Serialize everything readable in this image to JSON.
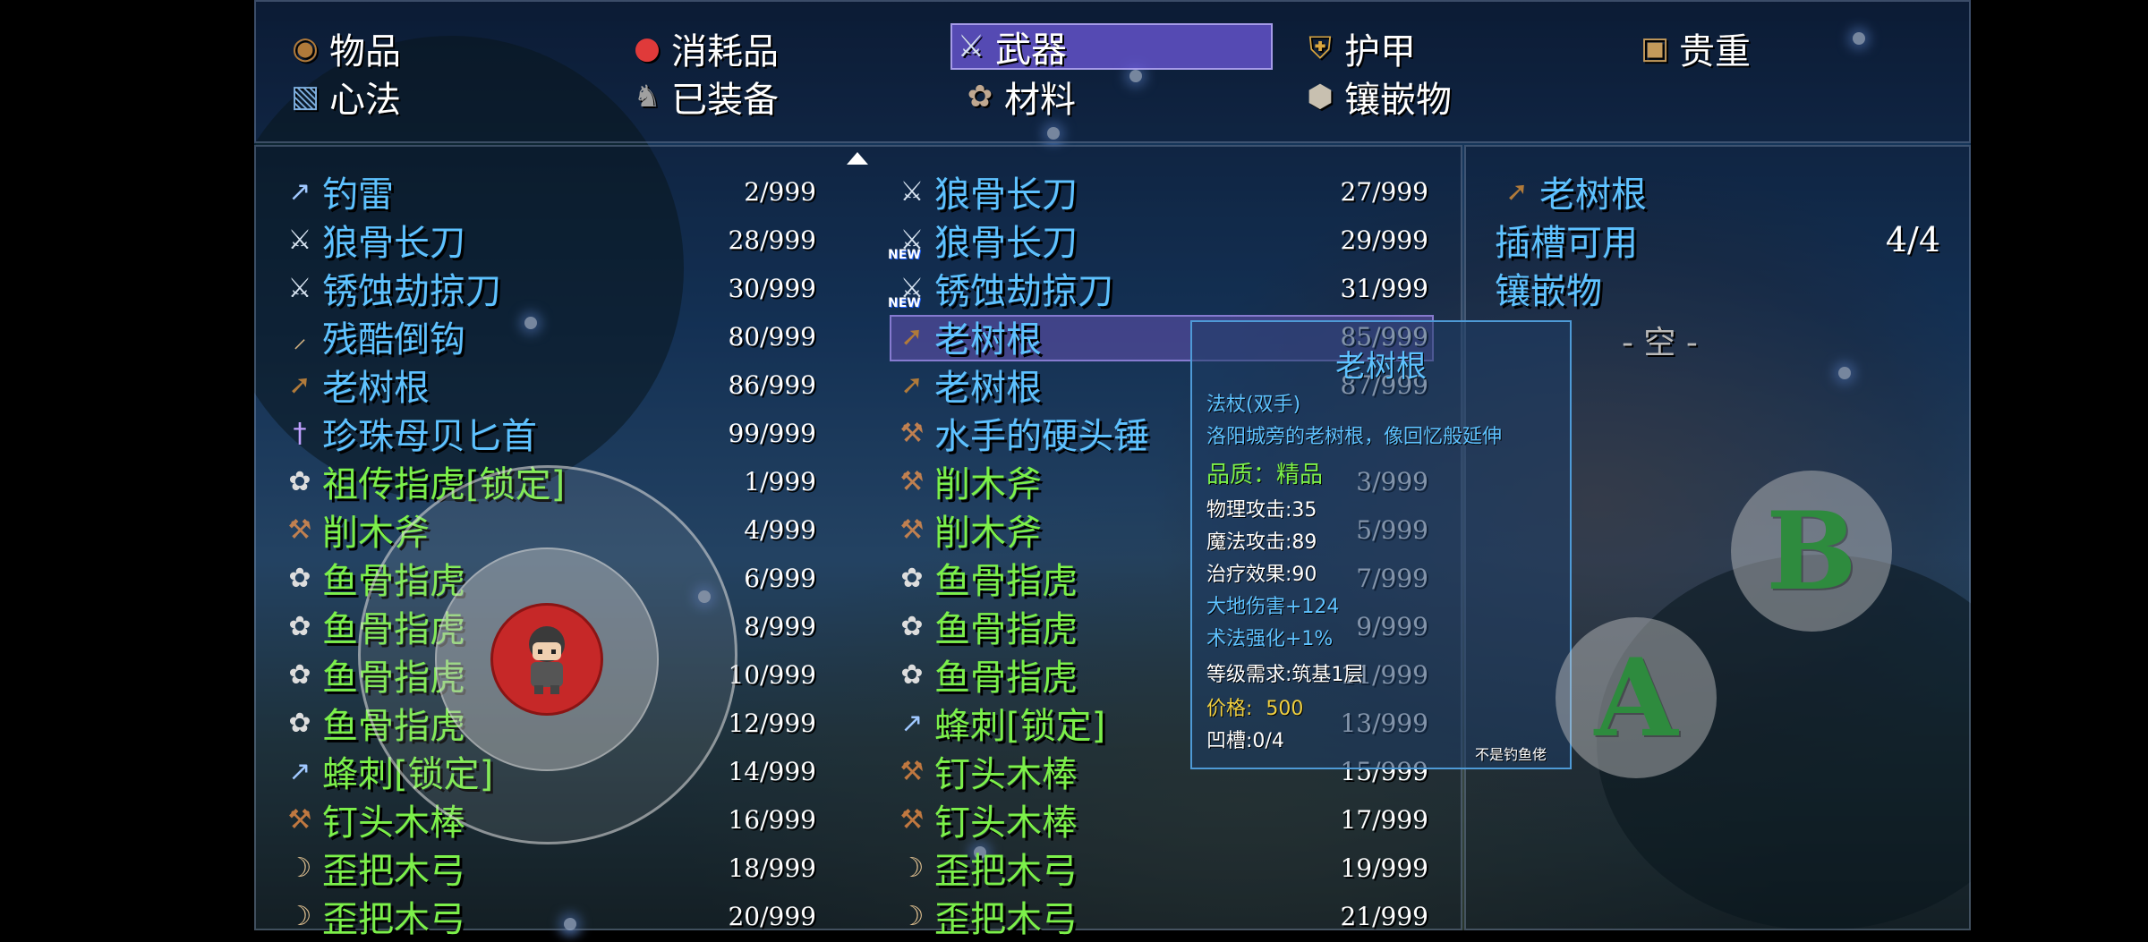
{
  "categories": [
    {
      "label": "物品",
      "icon": "bag-icon"
    },
    {
      "label": "消耗品",
      "icon": "potion-icon"
    },
    {
      "label": "武器",
      "icon": "sword-icon",
      "selected": true
    },
    {
      "label": "护甲",
      "icon": "shield-icon"
    },
    {
      "label": "贵重",
      "icon": "chest-icon"
    },
    {
      "label": "心法",
      "icon": "book-icon"
    },
    {
      "label": "已装备",
      "icon": "armor-icon"
    },
    {
      "label": "材料",
      "icon": "material-icon"
    },
    {
      "label": "镶嵌物",
      "icon": "gem-icon"
    }
  ],
  "list_left": [
    {
      "name": "钓雷",
      "count": "2/999",
      "color": "blue",
      "icon": "spear-icon"
    },
    {
      "name": "狼骨长刀",
      "count": "28/999",
      "color": "blue",
      "icon": "sword-icon"
    },
    {
      "name": "锈蚀劫掠刀",
      "count": "30/999",
      "color": "blue",
      "icon": "sword-icon"
    },
    {
      "name": "残酷倒钩",
      "count": "80/999",
      "color": "blue",
      "icon": "hook-blade-icon"
    },
    {
      "name": "老树根",
      "count": "86/999",
      "color": "blue",
      "icon": "staff-icon"
    },
    {
      "name": "珍珠母贝匕首",
      "count": "99/999",
      "color": "blue",
      "icon": "dagger-icon"
    },
    {
      "name": "祖传指虎[锁定]",
      "count": "1/999",
      "color": "green",
      "icon": "knuckle-icon"
    },
    {
      "name": "削木斧",
      "count": "4/999",
      "color": "green",
      "icon": "axe-icon"
    },
    {
      "name": "鱼骨指虎",
      "count": "6/999",
      "color": "green",
      "icon": "knuckle-icon"
    },
    {
      "name": "鱼骨指虎",
      "count": "8/999",
      "color": "green",
      "icon": "knuckle-icon"
    },
    {
      "name": "鱼骨指虎",
      "count": "10/999",
      "color": "green",
      "icon": "knuckle-icon"
    },
    {
      "name": "鱼骨指虎",
      "count": "12/999",
      "color": "green",
      "icon": "knuckle-icon"
    },
    {
      "name": "蜂刺[锁定]",
      "count": "14/999",
      "color": "green",
      "icon": "spear-icon"
    },
    {
      "name": "钉头木棒",
      "count": "16/999",
      "color": "green",
      "icon": "club-icon"
    },
    {
      "name": "歪把木弓",
      "count": "18/999",
      "color": "green",
      "icon": "bow-icon"
    },
    {
      "name": "歪把木弓",
      "count": "20/999",
      "color": "green",
      "icon": "bow-icon"
    }
  ],
  "list_right": [
    {
      "name": "狼骨长刀",
      "count": "27/999",
      "color": "blue",
      "icon": "sword-icon"
    },
    {
      "name": "狼骨长刀",
      "count": "29/999",
      "color": "blue",
      "icon": "sword-icon",
      "new": "NEW"
    },
    {
      "name": "锈蚀劫掠刀",
      "count": "31/999",
      "color": "blue",
      "icon": "sword-icon",
      "new": "NEW"
    },
    {
      "name": "老树根",
      "count": "85/999",
      "color": "blue",
      "icon": "staff-icon",
      "highlighted": true
    },
    {
      "name": "老树根",
      "count": "87/999",
      "color": "blue",
      "icon": "staff-icon"
    },
    {
      "name": "水手的硬头锤",
      "count": "",
      "color": "blue",
      "icon": "hammer-icon"
    },
    {
      "name": "削木斧",
      "count": "3/999",
      "color": "green",
      "icon": "axe-icon"
    },
    {
      "name": "削木斧",
      "count": "5/999",
      "color": "green",
      "icon": "axe-icon"
    },
    {
      "name": "鱼骨指虎",
      "count": "7/999",
      "color": "green",
      "icon": "knuckle-icon"
    },
    {
      "name": "鱼骨指虎",
      "count": "9/999",
      "color": "green",
      "icon": "knuckle-icon"
    },
    {
      "name": "鱼骨指虎",
      "count": "11/999",
      "color": "green",
      "icon": "knuckle-icon"
    },
    {
      "name": "蜂刺[锁定]",
      "count": "13/999",
      "color": "green",
      "icon": "spear-icon"
    },
    {
      "name": "钉头木棒",
      "count": "15/999",
      "color": "green",
      "icon": "club-icon"
    },
    {
      "name": "钉头木棒",
      "count": "17/999",
      "color": "green",
      "icon": "club-icon"
    },
    {
      "name": "歪把木弓",
      "count": "19/999",
      "color": "green",
      "icon": "bow-icon"
    },
    {
      "name": "歪把木弓",
      "count": "21/999",
      "color": "green",
      "icon": "bow-icon"
    }
  ],
  "detail": {
    "item_name": "老树根",
    "slots_label": "插槽可用",
    "slots_value": "4/4",
    "inlay_label": "镶嵌物",
    "empty_label": "- 空 -"
  },
  "tooltip": {
    "title": "老树根",
    "type": "法杖(双手)",
    "desc": "洛阳城旁的老树根，像回忆般延伸",
    "quality": "品质：精品",
    "phys_atk": "物理攻击:35",
    "mag_atk": "魔法攻击:89",
    "heal": "治疗效果:90",
    "earth_dmg": "大地伤害+124",
    "spell_boost": "术法强化+1%",
    "level_req": "等级需求:筑基1层",
    "price_label": "价格:",
    "price_value": "500",
    "sockets": "凹槽:0/4",
    "footer": "不是钓鱼佬"
  },
  "buttons": {
    "a": "A",
    "b": "B"
  },
  "colors": {
    "blue_text": "#5ec2ff",
    "green_text": "#7cf04a",
    "selected_tab": "#6e5adc",
    "joystick_knob": "#c62828",
    "button_letter": "#2e8b3e"
  }
}
